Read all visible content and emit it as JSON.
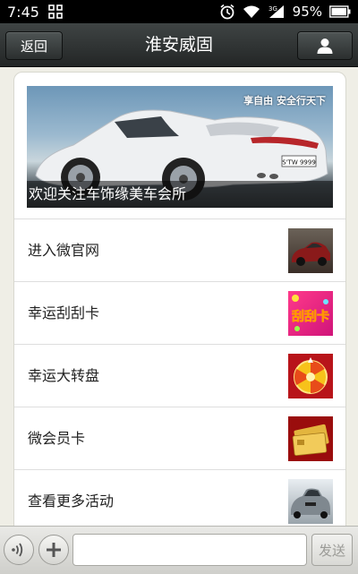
{
  "status_bar": {
    "time": "7:45",
    "battery": "95%",
    "icons": [
      "grid-icon",
      "alarm-icon",
      "wifi-icon",
      "signal-3g-icon",
      "battery-icon"
    ]
  },
  "nav": {
    "back_label": "返回",
    "title": "淮安威固",
    "profile_icon": "person-icon"
  },
  "banner": {
    "caption": "欢迎关注车饰缘美车会所",
    "tagline": "享自由 安全行天下",
    "plate": "S'TW 9999",
    "ghost_text": "车饰缘美车会所"
  },
  "menu": [
    {
      "label": "进入微官网",
      "thumb_icon": "car-thumb-icon"
    },
    {
      "label": "幸运刮刮卡",
      "thumb_icon": "scratch-card-thumb-icon",
      "thumb_text": "刮刮卡"
    },
    {
      "label": "幸运大转盘",
      "thumb_icon": "wheel-thumb-icon"
    },
    {
      "label": "微会员卡",
      "thumb_icon": "member-card-thumb-icon"
    },
    {
      "label": "查看更多活动",
      "thumb_icon": "bmw-thumb-icon"
    }
  ],
  "bottom_bar": {
    "voice_icon": "voice-icon",
    "plus_icon": "plus-icon",
    "input_value": "",
    "send_label": "发送"
  }
}
